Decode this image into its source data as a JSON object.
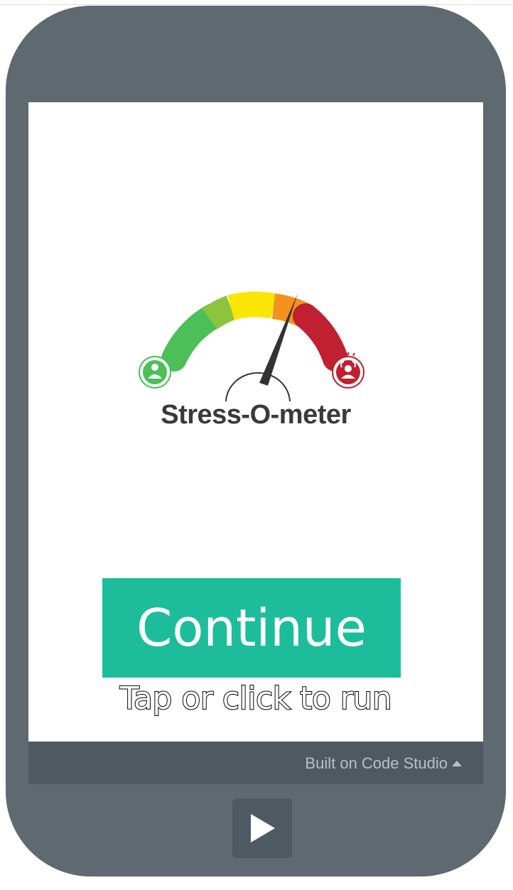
{
  "app": {
    "logo_text": "Stress-O-meter"
  },
  "main": {
    "continue_label": "Continue",
    "tap_hint": "Tap or click to run"
  },
  "footer": {
    "built_on_label": "Built on Code Studio"
  },
  "controls": {
    "run_icon": "play-icon"
  },
  "colors": {
    "phone_frame": "#5f6970",
    "footer_bar": "#4f5961",
    "continue_button": "#1dbd9c",
    "gauge_green": "#4cbf58",
    "gauge_light_green": "#8cc43f",
    "gauge_yellow": "#fbe504",
    "gauge_orange": "#f5921e",
    "gauge_red": "#c0202f"
  }
}
